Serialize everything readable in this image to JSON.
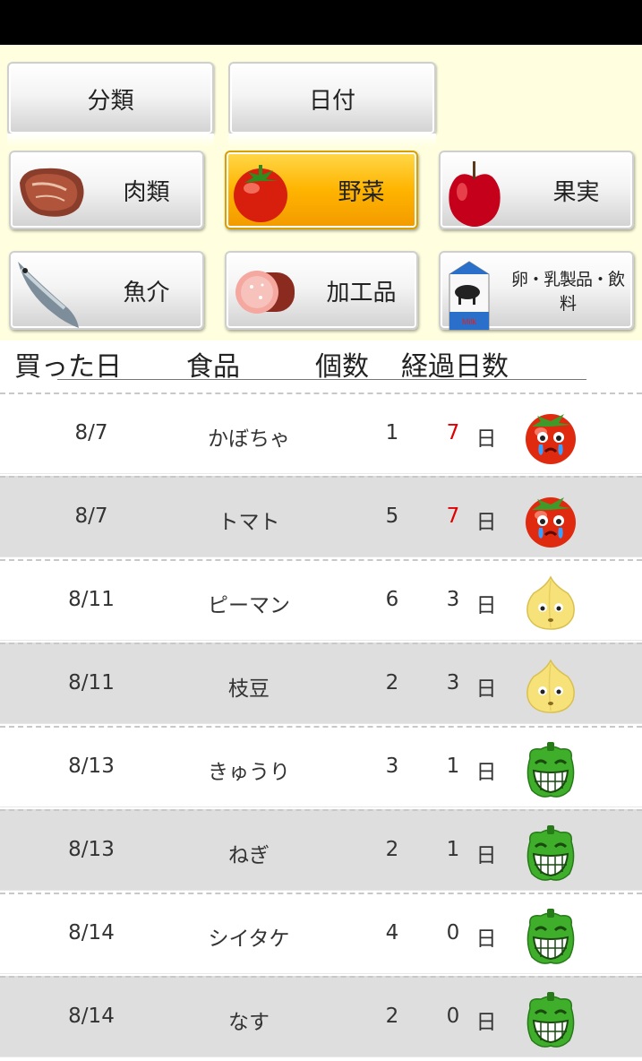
{
  "sort_tabs": [
    {
      "label": "分類"
    },
    {
      "label": "日付"
    }
  ],
  "categories": [
    {
      "label": "肉類",
      "icon": "meat-icon",
      "selected": false
    },
    {
      "label": "野菜",
      "icon": "tomato-icon",
      "selected": true
    },
    {
      "label": "果実",
      "icon": "apple-icon",
      "selected": false
    },
    {
      "label": "魚介",
      "icon": "fish-icon",
      "selected": false
    },
    {
      "label": "加工品",
      "icon": "ham-icon",
      "selected": false
    },
    {
      "label": "卵・乳製品・飲料",
      "icon": "milk-carton-icon",
      "selected": false
    }
  ],
  "table_header": {
    "date": "買った日",
    "food": "食品",
    "qty": "個数",
    "days": "経過日数"
  },
  "rows": [
    {
      "date": "8/7",
      "food": "かぼちゃ",
      "qty": "1",
      "days": "7",
      "unit": "日",
      "status": "crying-tomato-icon",
      "warn": true
    },
    {
      "date": "8/7",
      "food": "トマト",
      "qty": "5",
      "days": "7",
      "unit": "日",
      "status": "crying-tomato-icon",
      "warn": true
    },
    {
      "date": "8/11",
      "food": "ピーマン",
      "qty": "6",
      "days": "3",
      "unit": "日",
      "status": "worried-onion-icon",
      "warn": false
    },
    {
      "date": "8/11",
      "food": "枝豆",
      "qty": "2",
      "days": "3",
      "unit": "日",
      "status": "worried-onion-icon",
      "warn": false
    },
    {
      "date": "8/13",
      "food": "きゅうり",
      "qty": "3",
      "days": "1",
      "unit": "日",
      "status": "happy-pepper-icon",
      "warn": false
    },
    {
      "date": "8/13",
      "food": "ねぎ",
      "qty": "2",
      "days": "1",
      "unit": "日",
      "status": "happy-pepper-icon",
      "warn": false
    },
    {
      "date": "8/14",
      "food": "シイタケ",
      "qty": "4",
      "days": "0",
      "unit": "日",
      "status": "happy-pepper-icon",
      "warn": false
    },
    {
      "date": "8/14",
      "food": "なす",
      "qty": "2",
      "days": "0",
      "unit": "日",
      "status": "happy-pepper-icon",
      "warn": false
    }
  ],
  "colors": {
    "panel_bg": "#ffffe0",
    "selected_button": "#ffb400",
    "warn_days": "#e00000",
    "row_alt": "#dedede"
  }
}
